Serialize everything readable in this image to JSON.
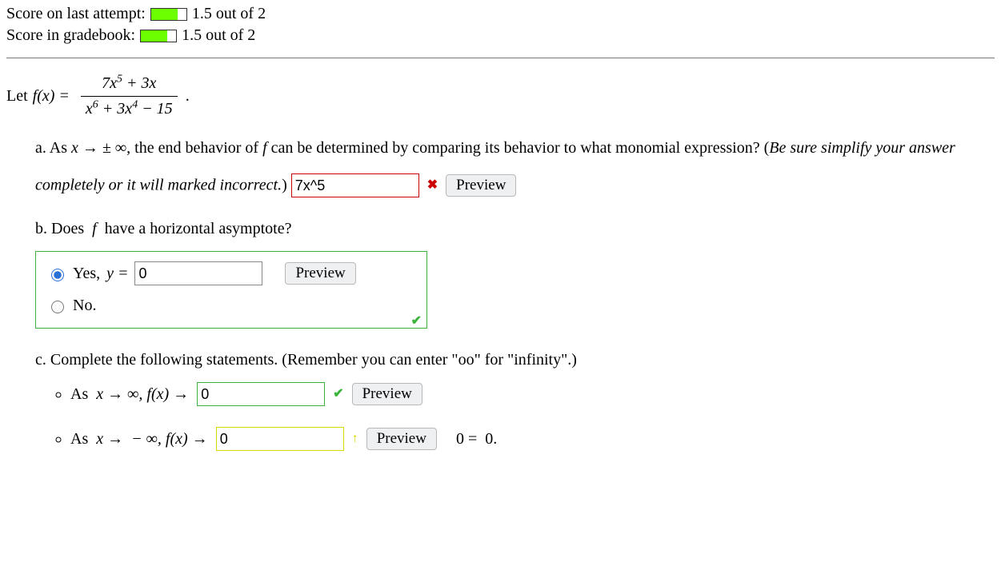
{
  "scores": {
    "last_label": "Score on last attempt:",
    "last_value": "1.5 out of 2",
    "last_fill_pct": 75,
    "book_label": "Score in gradebook:",
    "book_value": "1.5 out of 2",
    "book_fill_pct": 75
  },
  "problem": {
    "lead": "Let ",
    "fx": "f(x) = ",
    "numerator": "7x⁵ + 3x",
    "denominator": "x⁶ + 3x⁴ − 15",
    "period": "."
  },
  "parts": {
    "a": {
      "text_1": "As ",
      "text_2": "x → ± ∞",
      "text_3": ", the end behavior of ",
      "text_4": "f",
      "text_5": " can be determined by comparing its behavior to what monomial expression? (",
      "hint": "Be sure simplify your answer completely or it will marked incorrect.",
      "close": ")",
      "input_value": "7x^5",
      "preview": "Preview"
    },
    "b": {
      "text": "Does  f  have a horizontal asymptote?",
      "yes_label": "Yes, ",
      "yes_eq": "y = ",
      "yes_value": "0",
      "no_label": "No.",
      "preview": "Preview"
    },
    "c": {
      "text": "Complete the following statements. (Remember you can enter \"oo\" for \"infinity\".)",
      "row1_prefix": "As ",
      "row1_mid": "x → ∞, f(x) → ",
      "row1_value": "0",
      "row2_prefix": "As ",
      "row2_mid": "x →  − ∞, f(x) → ",
      "row2_value": "0",
      "row2_tail_a": "0",
      "row2_tail_b": " = ",
      "row2_tail_c": "0.",
      "preview": "Preview"
    }
  }
}
